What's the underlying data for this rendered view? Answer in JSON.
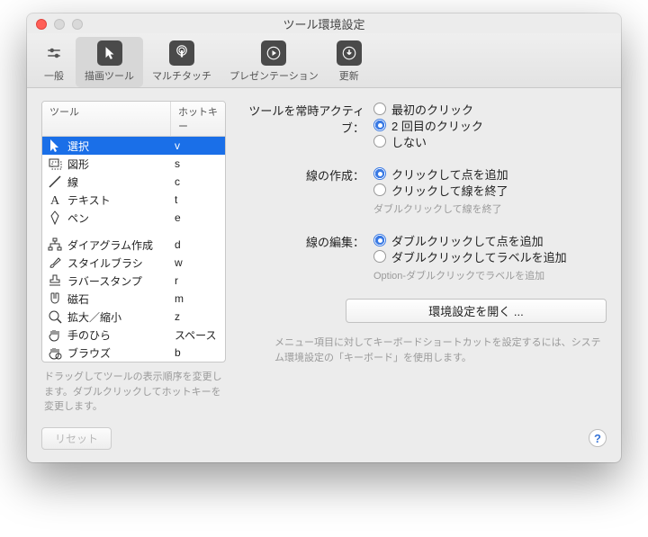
{
  "title": "ツール環境設定",
  "toolbar": [
    {
      "label": "一般"
    },
    {
      "label": "描画ツール"
    },
    {
      "label": "マルチタッチ"
    },
    {
      "label": "プレゼンテーション"
    },
    {
      "label": "更新"
    }
  ],
  "columns": {
    "tool": "ツール",
    "hotkey": "ホットキー"
  },
  "tools": [
    {
      "name": "選択",
      "key": "v",
      "icon": "cursor",
      "sel": true
    },
    {
      "name": "図形",
      "key": "s",
      "icon": "rect"
    },
    {
      "name": "線",
      "key": "c",
      "icon": "line"
    },
    {
      "name": "テキスト",
      "key": "t",
      "icon": "text"
    },
    {
      "name": "ペン",
      "key": "e",
      "icon": "pen"
    }
  ],
  "tools2": [
    {
      "name": "ダイアグラム作成",
      "key": "d",
      "icon": "diagram"
    },
    {
      "name": "スタイルブラシ",
      "key": "w",
      "icon": "brush"
    },
    {
      "name": "ラバースタンプ",
      "key": "r",
      "icon": "stamp"
    },
    {
      "name": "磁石",
      "key": "m",
      "icon": "magnet"
    },
    {
      "name": "拡大／縮小",
      "key": "z",
      "icon": "zoom"
    },
    {
      "name": "手のひら",
      "key": "スペース",
      "icon": "hand"
    },
    {
      "name": "ブラウズ",
      "key": "b",
      "icon": "browse"
    }
  ],
  "leftHint": "ドラッグしてツールの表示順序を変更します。ダブルクリックしてホットキーを変更します。",
  "groups": {
    "active": {
      "label": "ツールを常時アクティブ：",
      "options": [
        "最初のクリック",
        "2 回目のクリック",
        "しない"
      ],
      "selected": 1
    },
    "createLine": {
      "label": "線の作成：",
      "options": [
        "クリックして点を追加",
        "クリックして線を終了"
      ],
      "selected": 0,
      "hint": "ダブルクリックして線を終了"
    },
    "editLine": {
      "label": "線の編集：",
      "options": [
        "ダブルクリックして点を追加",
        "ダブルクリックしてラベルを追加"
      ],
      "selected": 0,
      "hint": "Option-ダブルクリックでラベルを追加"
    }
  },
  "openPrefs": "環境設定を開く ...",
  "rightHint": "メニュー項目に対してキーボードショートカットを設定するには、システム環境設定の「キーボード」を使用します。",
  "reset": "リセット"
}
